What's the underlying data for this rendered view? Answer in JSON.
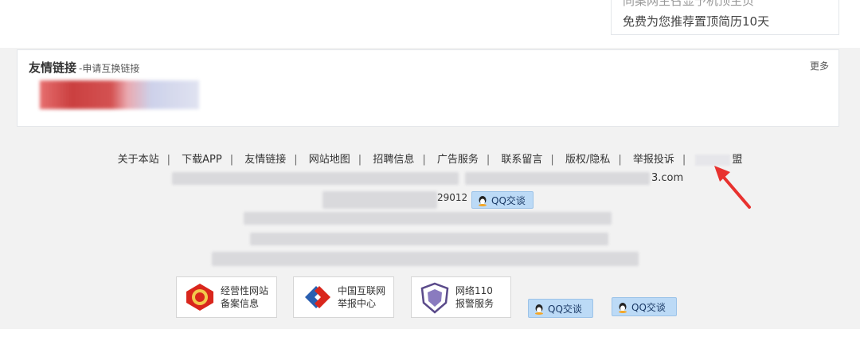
{
  "promo": {
    "line1": "同案网主召显予机顶主页",
    "line2": "免费为您推荐置顶简历10天"
  },
  "friend_links": {
    "title": "友情链接",
    "apply": "-申请互换链接",
    "more": "更多"
  },
  "footer_nav": [
    "关于本站",
    "下载APP",
    "友情链接",
    "网站地图",
    "招聘信息",
    "广告服务",
    "联系留言",
    "版权/隐私",
    "举报投诉",
    "盟"
  ],
  "footer_text": {
    "domain_suffix": "3.com",
    "number_fragment": "29012",
    "qq_label": "QQ交谈"
  },
  "badges": [
    {
      "line1": "经营性网站",
      "line2": "备案信息",
      "icon": "police-emblem-icon"
    },
    {
      "line1": "中国互联网",
      "line2": "举报中心",
      "icon": "report-center-icon"
    },
    {
      "line1": "网络110",
      "line2": "报警服务",
      "icon": "police-shield-icon"
    }
  ],
  "qq_buttons": [
    "QQ交谈",
    "QQ交谈"
  ],
  "colors": {
    "qq_bg": "#bcdaf6",
    "arrow": "#e8322f",
    "badge_red": "#d9261c",
    "badge_blue": "#2a5fb0"
  }
}
